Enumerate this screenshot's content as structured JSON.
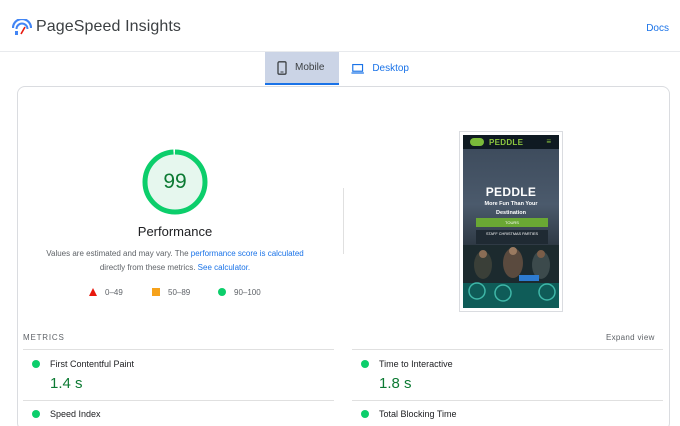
{
  "header": {
    "title": "PageSpeed Insights",
    "docs_label": "Docs"
  },
  "tabs": [
    {
      "label": "Mobile",
      "icon": "phone-icon",
      "active": true
    },
    {
      "label": "Desktop",
      "icon": "laptop-icon",
      "active": false
    }
  ],
  "performance": {
    "score": "99",
    "score_fraction": 0.99,
    "title": "Performance",
    "note_prefix": "Values are estimated and may vary. The ",
    "note_link1": "performance score is calculated",
    "note_middle": " directly from these metrics. ",
    "note_link2": "See calculator.",
    "ring_color": "#0cce6b",
    "score_color": "#0c7a33"
  },
  "legend": [
    {
      "label": "0–49",
      "shape": "triangle",
      "color": "#e8190e"
    },
    {
      "label": "50–89",
      "shape": "square",
      "color": "#f6a21b"
    },
    {
      "label": "90–100",
      "shape": "circle",
      "color": "#0cce6b"
    }
  ],
  "screenshot": {
    "brand": "PEDDLE",
    "menu_glyph": "≡",
    "headline": "PEDDLE",
    "subline": "More Fun Than Your Destination",
    "button1": "TOURS",
    "button2": "STAFF CHRISTMAS PARTIES",
    "accent": "#8cc63f"
  },
  "metrics": {
    "section_label": "METRICS",
    "expand_label": "Expand view",
    "items": [
      {
        "name": "First Contentful Paint",
        "value": "1.4 s"
      },
      {
        "name": "Time to Interactive",
        "value": "1.8 s"
      },
      {
        "name": "Speed Index",
        "value": ""
      },
      {
        "name": "Total Blocking Time",
        "value": ""
      }
    ]
  }
}
